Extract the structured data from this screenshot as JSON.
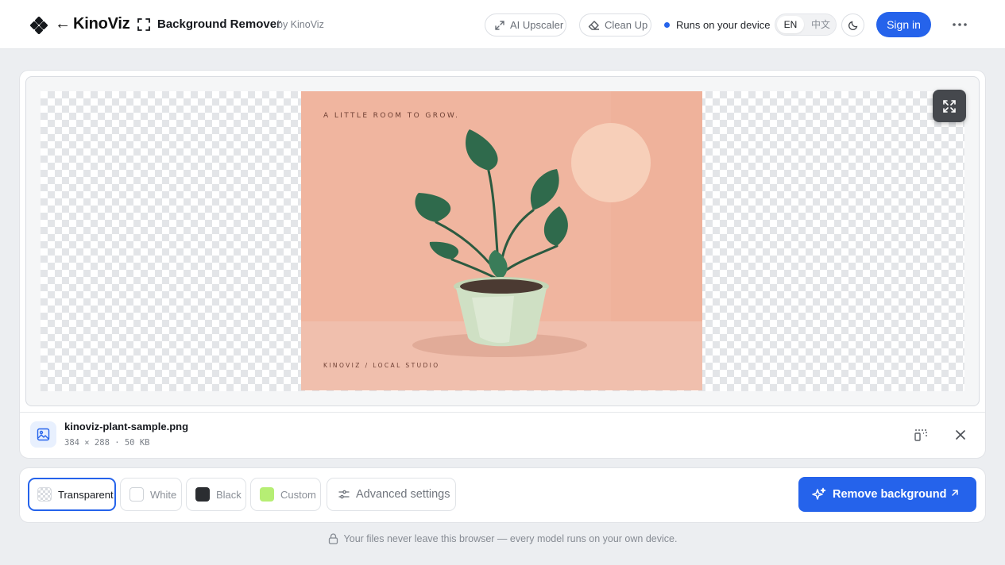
{
  "header": {
    "brand": "KinoViz",
    "back_arrow": "←",
    "tool_title": "Background Remover",
    "by_line": "by KinoViz",
    "links": {
      "upscaler": "AI Upscaler",
      "cleanup": "Clean Up"
    },
    "device_status": "Runs on your device",
    "lang": {
      "en": "EN",
      "zh": "中文",
      "active": "EN"
    },
    "sign_in": "Sign in"
  },
  "preview": {
    "artwork_tagline": "A LITTLE ROOM TO GROW.",
    "artwork_footer": "KINOVIZ / LOCAL STUDIO",
    "colors": {
      "peach": "#f0b59f",
      "sun": "#f7cfb9",
      "floor": "#f0bfad",
      "leaf": "#2f6a4c",
      "pot": "#cfe0c4"
    }
  },
  "file": {
    "name": "kinoviz-plant-sample.png",
    "meta": "384 × 288 · 50 KB"
  },
  "toolbar": {
    "options": [
      {
        "label": "Transparent",
        "selected": true
      },
      {
        "label": "White"
      },
      {
        "label": "Black"
      },
      {
        "label": "Custom",
        "color": "#b6ee74"
      }
    ],
    "advanced": "Advanced settings",
    "remove": "Remove background"
  },
  "footer": {
    "privacy": "Your files never leave this browser — every model runs on your own device."
  },
  "theme": {
    "accent": "#2563eb"
  }
}
